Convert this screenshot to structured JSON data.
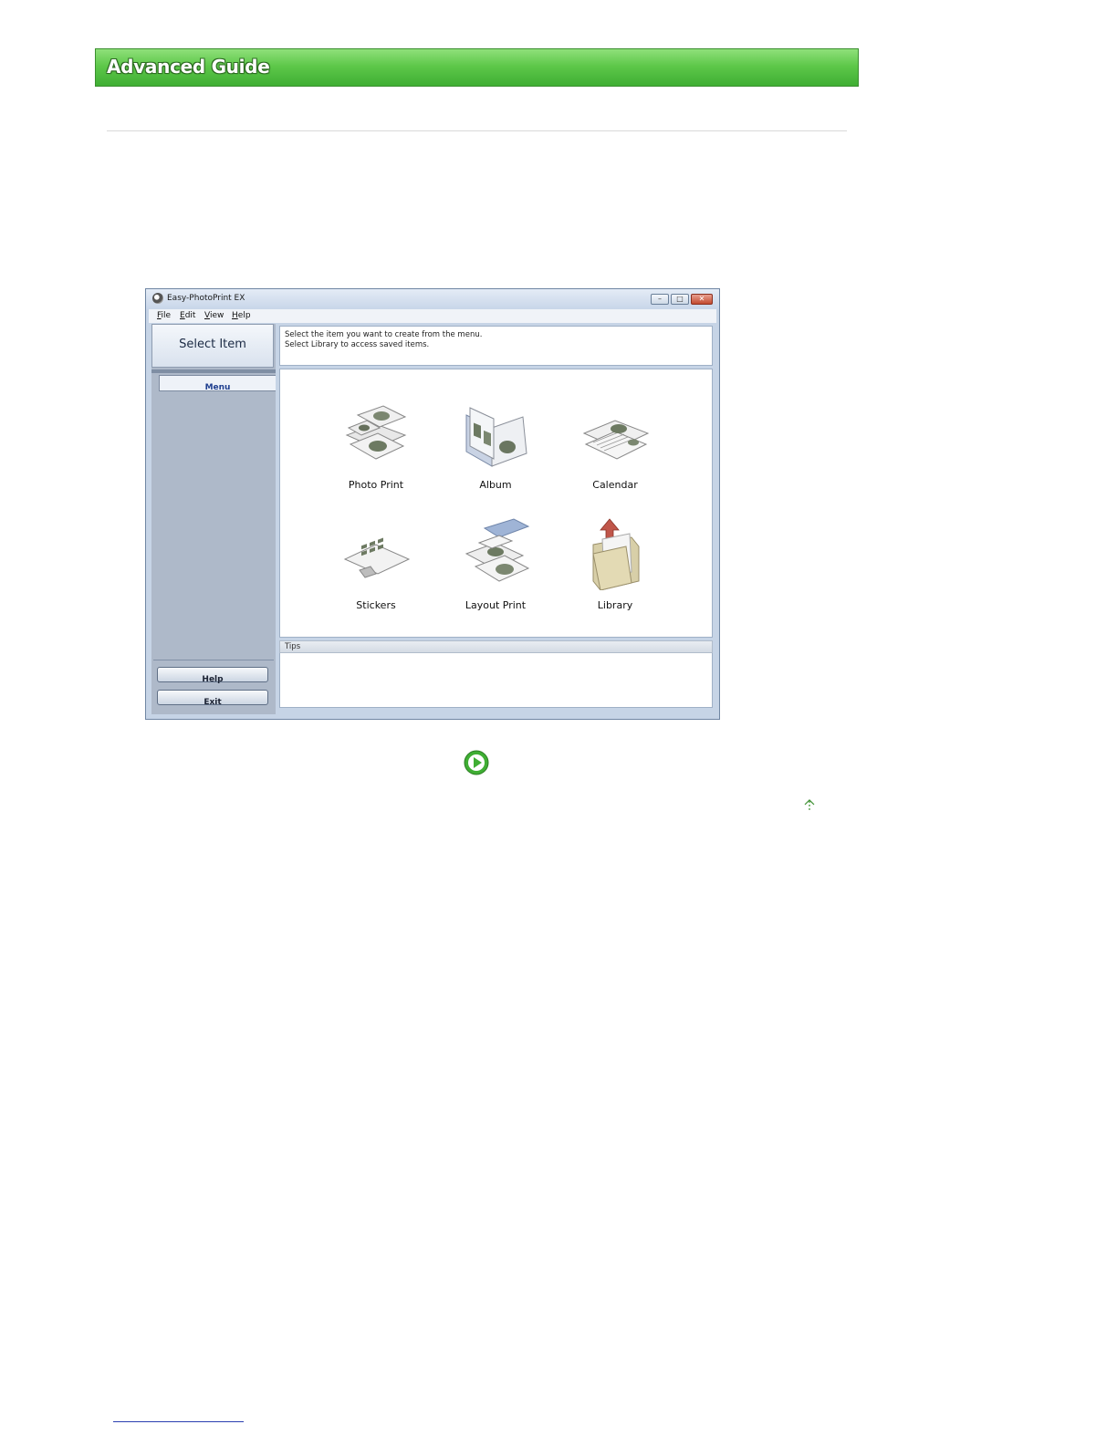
{
  "header": {
    "title": "Advanced Guide",
    "accent_color": "#4cba3a"
  },
  "window": {
    "title": "Easy-PhotoPrint EX",
    "controls": {
      "minimize": "–",
      "maximize": "□",
      "close": "✕"
    },
    "menubar": [
      "File",
      "Edit",
      "View",
      "Help"
    ],
    "left_panel": {
      "title": "Select Item",
      "active_tab": "Menu",
      "help_button": "Help",
      "exit_button": "Exit"
    },
    "instructions": [
      "Select the item you want to create from the menu.",
      "Select Library to access saved items."
    ],
    "items": [
      {
        "label": "Photo Print",
        "icon": "photo-print-icon"
      },
      {
        "label": "Album",
        "icon": "album-icon"
      },
      {
        "label": "Calendar",
        "icon": "calendar-icon"
      },
      {
        "label": "Stickers",
        "icon": "stickers-icon"
      },
      {
        "label": "Layout Print",
        "icon": "layout-print-icon"
      },
      {
        "label": "Library",
        "icon": "library-icon"
      }
    ],
    "tips_label": "Tips"
  },
  "navigation": {
    "play_icon": "play-icon",
    "top_icon": "page-top-icon"
  }
}
